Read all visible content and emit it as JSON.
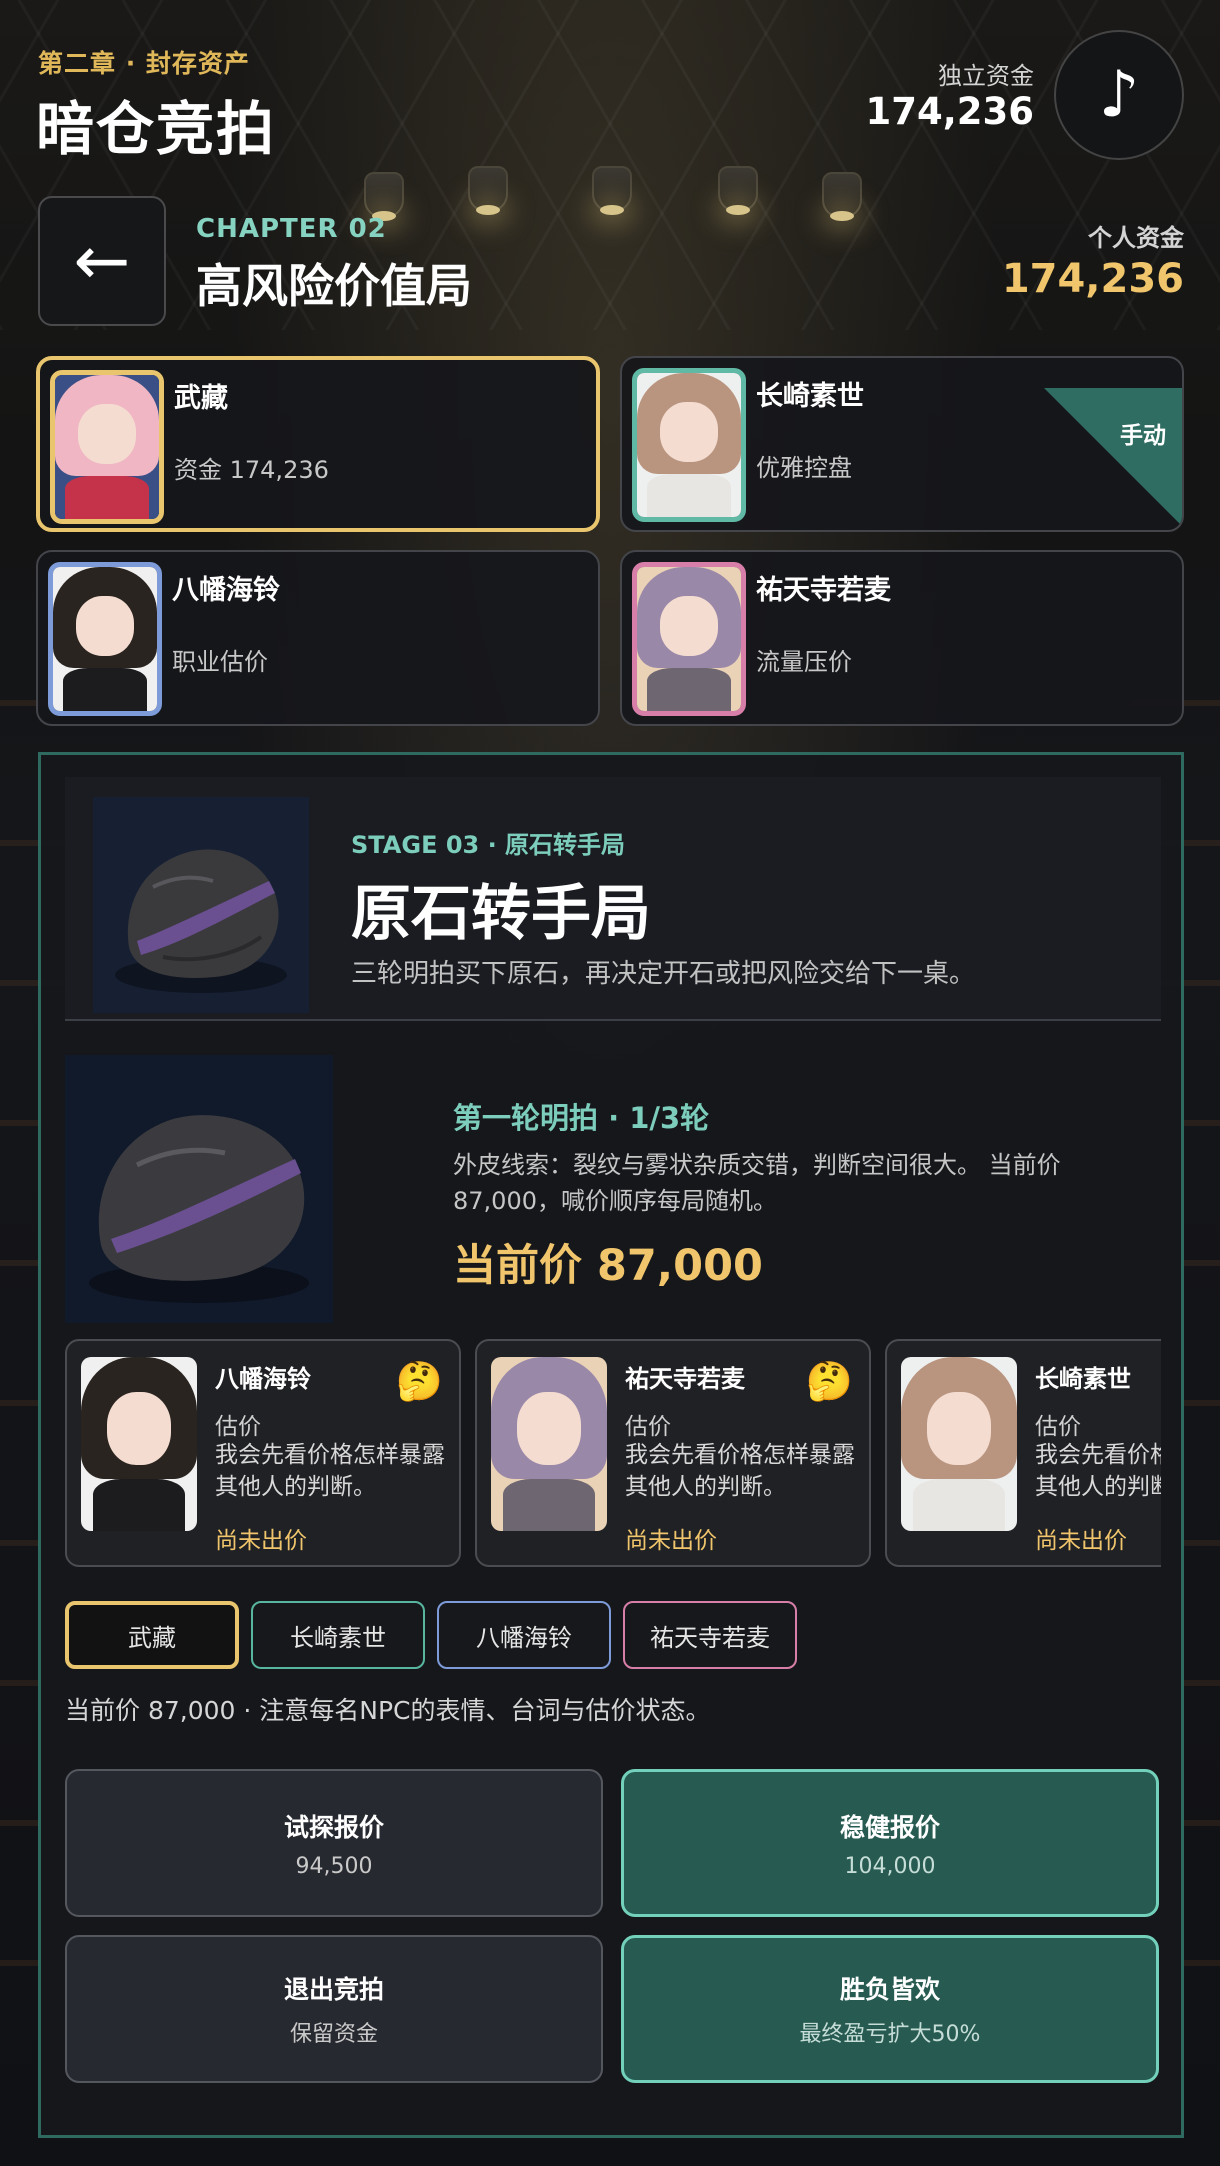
{
  "header": {
    "chapter_sub": "第二章 · 封存资产",
    "title": "暗仓竞拍",
    "funds_label": "独立资金",
    "funds_value": "174,236",
    "music_icon": "♪"
  },
  "chapter": {
    "back_icon": "←",
    "code": "CHAPTER 02",
    "name": "高风险价值局",
    "personal_funds_label": "个人资金",
    "personal_funds_value": "174,236"
  },
  "players": [
    {
      "name": "武藏",
      "desc": "资金 174,236",
      "frame_color": "#e9c56e",
      "hair": "#f0b6c4",
      "active": true
    },
    {
      "name": "长崎素世",
      "desc": "优雅控盘",
      "frame_color": "#5fb9a5",
      "hair": "#b99580",
      "badge": "手动"
    },
    {
      "name": "八幡海铃",
      "desc": "职业估价",
      "frame_color": "#7d9bd8",
      "hair": "#2a2420"
    },
    {
      "name": "祐天寺若麦",
      "desc": "流量压价",
      "frame_color": "#d87fa9",
      "hair": "#9a88a8"
    }
  ],
  "stage": {
    "code": "STAGE 03 · 原石转手局",
    "title": "原石转手局",
    "desc": "三轮明拍买下原石，再决定开石或把风险交给下一桌。"
  },
  "round": {
    "title": "第一轮明拍 · 1/3轮",
    "clue": "外皮线索：裂纹与雾状杂质交错，判断空间很大。 当前价 87,000，喊价顺序每局随机。",
    "price": "当前价 87,000"
  },
  "npcs": [
    {
      "name": "八幡海铃",
      "emoji": "🤔",
      "state": "估价",
      "line": "我会先看价格怎样暴露其他人的判断。",
      "bid": "尚未出价",
      "hair": "#2a2420"
    },
    {
      "name": "祐天寺若麦",
      "emoji": "🤔",
      "state": "估价",
      "line": "我会先看价格怎样暴露其他人的判断。",
      "bid": "尚未出价",
      "hair": "#9a88a8"
    },
    {
      "name": "长崎素世",
      "emoji": "",
      "state": "估价",
      "line": "我会先看价格怎样暴露其他人的判断。",
      "bid": "尚未出价",
      "hair": "#b99580"
    }
  ],
  "tabs": [
    "武藏",
    "长崎素世",
    "八幡海铃",
    "祐天寺若麦"
  ],
  "hint": "当前价 87,000 · 注意每名NPC的表情、台词与估价状态。",
  "actions": {
    "probe": {
      "label": "试探报价",
      "sub": "94,500"
    },
    "steady": {
      "label": "稳健报价",
      "sub": "104,000"
    },
    "exit": {
      "label": "退出竞拍",
      "sub": "保留资金"
    },
    "allin": {
      "label": "胜负皆欢",
      "sub": "最终盈亏扩大50%"
    }
  }
}
